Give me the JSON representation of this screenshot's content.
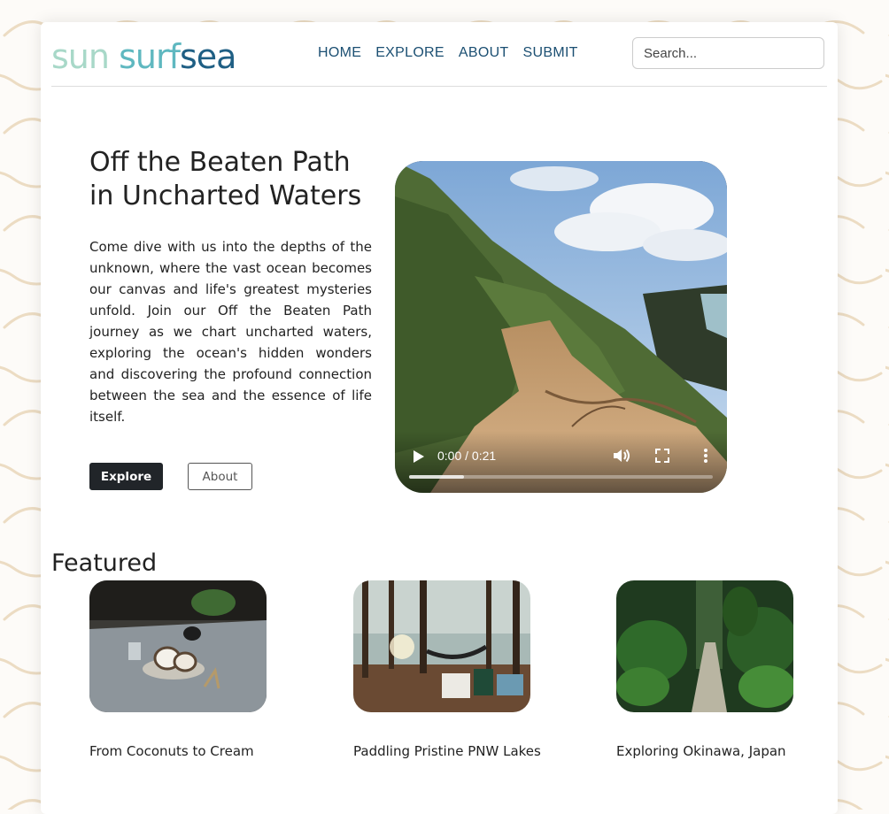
{
  "brand": {
    "part1": "sun",
    "part2": "surf",
    "part3": "sea"
  },
  "nav": {
    "items": [
      "HOME",
      "EXPLORE",
      "ABOUT",
      "SUBMIT"
    ]
  },
  "search": {
    "placeholder": "Search..."
  },
  "hero": {
    "title": "Off the Beaten Path in Uncharted Waters",
    "text": "Come dive with us into the depths of the unknown, where the vast ocean becomes our canvas and life's greatest mysteries unfold. Join our Off the Beaten Path journey as we chart uncharted waters, exploring the ocean's hidden wonders and discovering the profound connection between the sea and the essence of life itself.",
    "primary_button": "Explore",
    "secondary_button": "About"
  },
  "video": {
    "time": "0:00 / 0:21",
    "buffered_fraction": 0.18
  },
  "featured": {
    "heading": "Featured",
    "cards": [
      {
        "title": "From Coconuts to Cream"
      },
      {
        "title": "Paddling Pristine PNW Lakes"
      },
      {
        "title": "Exploring Okinawa, Japan"
      }
    ]
  },
  "colors": {
    "logo_light": "#a8d8c8",
    "logo_mid": "#5fb8c0",
    "logo_dark": "#1f5f84",
    "nav_link": "#1b4f72",
    "button_dark": "#212529",
    "wave_pattern": "#ecdcc3"
  }
}
